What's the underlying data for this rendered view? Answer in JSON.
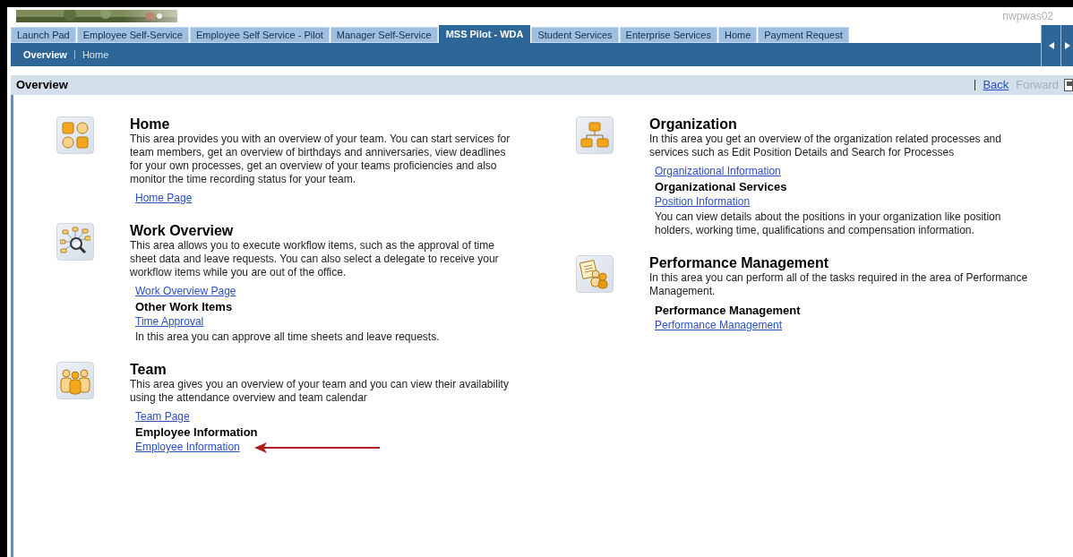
{
  "header": {
    "system": "nwpwas02"
  },
  "tabs": [
    {
      "label": "Launch Pad",
      "selected": false
    },
    {
      "label": "Employee Self-Service",
      "selected": false
    },
    {
      "label": "Employee Self Service - Pilot",
      "selected": false
    },
    {
      "label": "Manager Self-Service",
      "selected": false
    },
    {
      "label": "MSS Pilot - WDA",
      "selected": true
    },
    {
      "label": "Student Services",
      "selected": false
    },
    {
      "label": "Enterprise Services",
      "selected": false
    },
    {
      "label": "Home",
      "selected": false
    },
    {
      "label": "Payment Request",
      "selected": false
    }
  ],
  "subnav": [
    {
      "label": "Overview",
      "selected": true
    },
    {
      "label": "Home",
      "selected": false
    }
  ],
  "page_title": "Overview",
  "history": {
    "back": "Back",
    "forward": "Forward",
    "forward_disabled": true
  },
  "columns": [
    [
      {
        "kind": "grid",
        "title": "Home",
        "description": "This area provides you with an overview of your team. You can start services for team members, get an overview of birthdays and anniversaries, view deadlines for your own processes, get an overview of your teams proficiencies and also monitor the time recording status for your team.",
        "items": [
          {
            "kind": "link",
            "text": "Home Page"
          }
        ]
      },
      {
        "kind": "search",
        "title": "Work Overview",
        "description": "This area allows you to execute workflow items, such as the approval of time sheet data and leave requests. You can also select a delegate to receive your workflow items while you are out of the office.",
        "items": [
          {
            "kind": "link",
            "text": "Work Overview Page"
          },
          {
            "kind": "heading",
            "text": "Other Work Items"
          },
          {
            "kind": "link",
            "text": "Time Approval"
          },
          {
            "kind": "text",
            "text": "In this area you can approve all time sheets and leave requests."
          }
        ]
      },
      {
        "kind": "people",
        "title": "Team",
        "description": "This area gives you an overview of your team and you can view their availability using the attendance overview and team calendar",
        "items": [
          {
            "kind": "link",
            "text": "Team Page"
          },
          {
            "kind": "heading",
            "text": "Employee Information"
          },
          {
            "kind": "link",
            "text": "Employee Information",
            "pointer": true
          }
        ]
      }
    ],
    [
      {
        "kind": "org",
        "title": "Organization",
        "description": "In this area you get an overview of the organization related processes and services such as Edit Position Details and Search for Processes",
        "items": [
          {
            "kind": "link",
            "text": "Organizational Information"
          },
          {
            "kind": "heading",
            "text": "Organizational Services"
          },
          {
            "kind": "link",
            "text": "Position Information"
          },
          {
            "kind": "text",
            "text": "You can view details about the positions in your organization like position holders, working time, qualifications and compensation information."
          }
        ]
      },
      {
        "kind": "performance",
        "title": "Performance Management",
        "description": "In this area you can perform all of the tasks required in the area of Performance Management.",
        "items": [
          {
            "kind": "heading",
            "text": "Performance Management"
          },
          {
            "kind": "link",
            "text": "Performance Management"
          }
        ]
      }
    ]
  ]
}
